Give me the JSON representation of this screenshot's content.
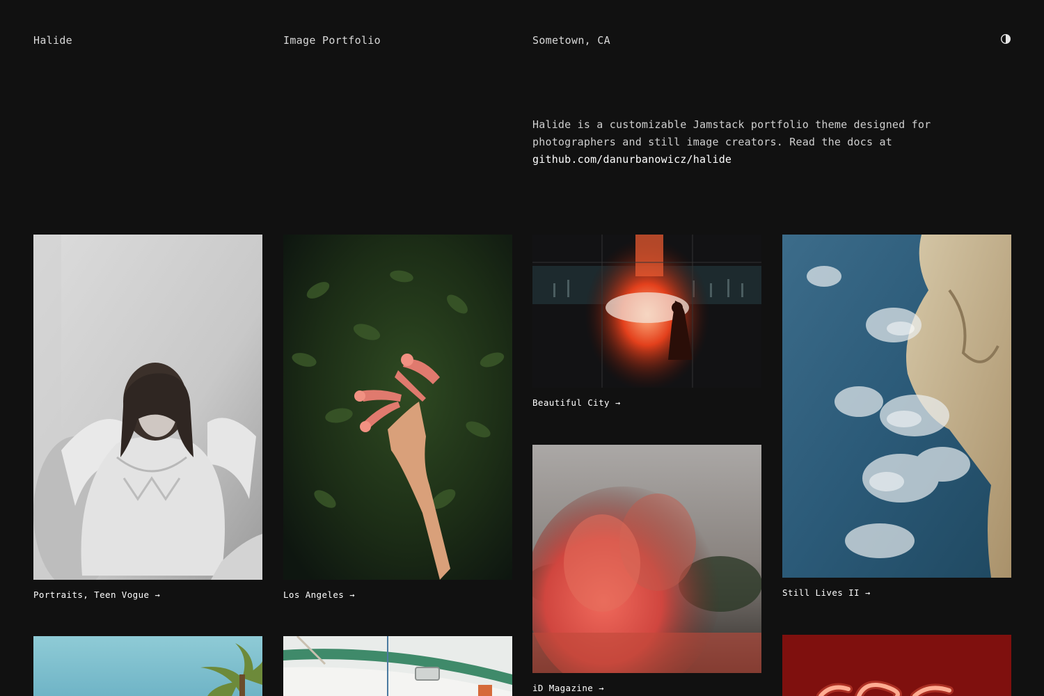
{
  "header": {
    "brand": "Halide",
    "subtitle": "Image Portfolio",
    "location": "Sometown, CA",
    "theme_toggle_icon": "contrast-icon"
  },
  "intro": {
    "text": "Halide is a customizable Jamstack portfolio theme designed for photographers and still image creators. Read the docs at",
    "link_text": "github.com/danurbanowicz/halide"
  },
  "gallery": {
    "arrow": "→",
    "items": [
      {
        "title": "Portraits, Teen Vogue"
      },
      {
        "title": "Los Angeles"
      },
      {
        "title": "Beautiful City"
      },
      {
        "title": "Still Lives II"
      },
      {
        "title": "iD Magazine"
      },
      {
        "title": ""
      },
      {
        "title": ""
      },
      {
        "title": ""
      }
    ]
  },
  "colors": {
    "background": "#111111",
    "text": "#d8d8d8",
    "link": "#ffffff"
  }
}
